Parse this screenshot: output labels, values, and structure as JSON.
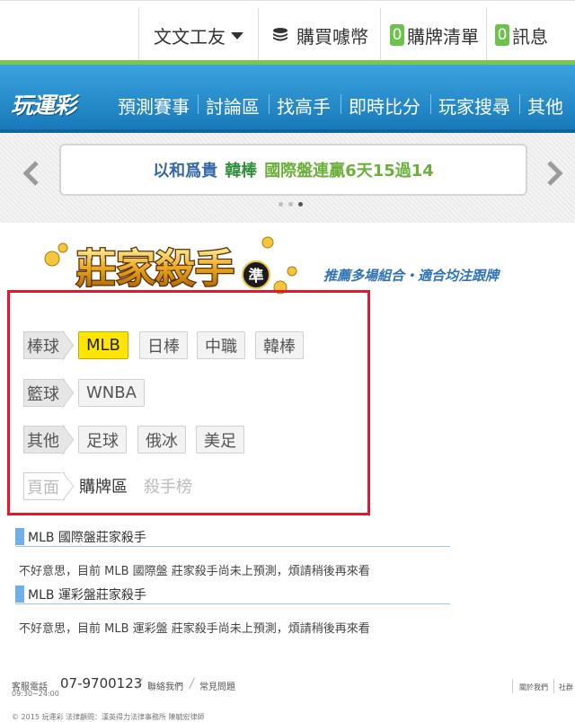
{
  "topbar": {
    "user_name": "文文工友",
    "buy_coins": "購買噱幣",
    "cart_count": "0",
    "cart_label": "購牌清單",
    "msg_count": "0",
    "msg_label": "訊息"
  },
  "nav": {
    "logo": "玩運彩",
    "items": [
      "預測賽事",
      "討論區",
      "找高手",
      "即時比分",
      "玩家搜尋",
      "其他"
    ]
  },
  "ticker": {
    "part1": "以和爲貴",
    "part2": "韓棒",
    "part3": "國際盤連贏6天15過14"
  },
  "banner": {
    "title": "莊家殺手",
    "badge": "準",
    "slogan": "推薦多場組合・適合均注跟牌"
  },
  "filters": {
    "baseball_label": "棒球",
    "baseball": [
      "MLB",
      "日棒",
      "中職",
      "韓棒"
    ],
    "basketball_label": "籃球",
    "basketball": [
      "WNBA"
    ],
    "other_label": "其他",
    "other": [
      "足球",
      "俄冰",
      "美足"
    ],
    "page_label": "頁面",
    "page_current": "購牌區",
    "page_other": "殺手榜"
  },
  "sections": [
    {
      "title": "MLB 國際盤莊家殺手",
      "message": "不好意思，目前 MLB 國際盤 莊家殺手尚未上預測，煩請稍後再來看"
    },
    {
      "title": "MLB 運彩盤莊家殺手",
      "message": "不好意思，目前 MLB 運彩盤 莊家殺手尚未上預測，煩請稍後再來看"
    }
  ],
  "footer": {
    "service_label": "客服電話",
    "hours": "09:30~24:00",
    "phone": "07-9700123",
    "contact": "聯絡我們",
    "faq": "常見問題",
    "about": "關於我們",
    "social": "社群",
    "copyright": "© 2015 玩運彩 法律顧問：漢英得力法律事務所 陳毓宏律師"
  },
  "colors": {
    "accent_green": "#7ac64a",
    "nav_blue": "#1f87c9",
    "active_chip": "#ffe500",
    "highlight_border": "#e3182d"
  }
}
